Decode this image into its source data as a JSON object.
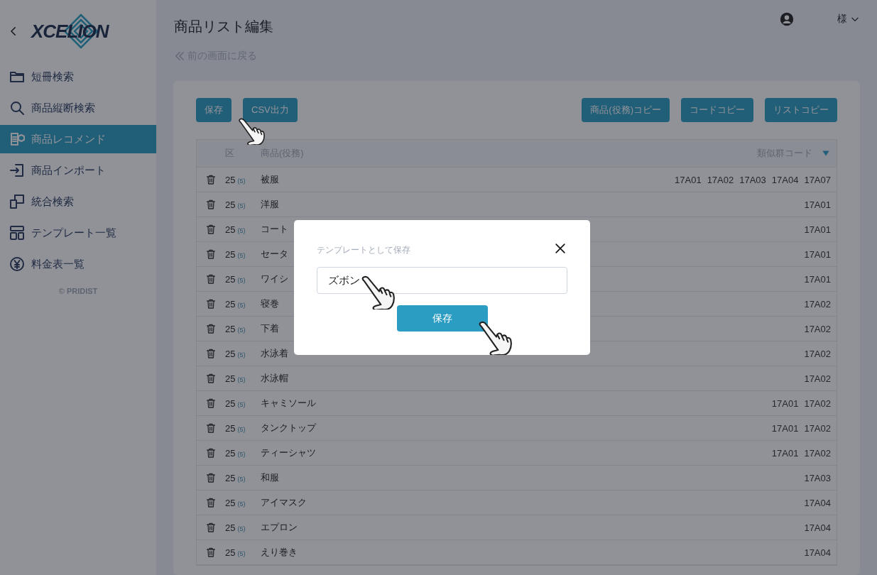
{
  "sidebar": {
    "logo": "XCELION",
    "items": [
      {
        "label": "短冊検索",
        "selected": false
      },
      {
        "label": "商品縦断検索",
        "selected": false
      },
      {
        "label": "商品レコメンド",
        "selected": true
      },
      {
        "label": "商品インポート",
        "selected": false
      },
      {
        "label": "統合検索",
        "selected": false
      },
      {
        "label": "テンプレート一覧",
        "selected": false
      },
      {
        "label": "料金表一覧",
        "selected": false
      }
    ],
    "copyright": "© PRIDIST"
  },
  "header": {
    "title": "商品リスト編集",
    "user_suffix": "様",
    "back_link": "前の画面に戻る"
  },
  "toolbar": {
    "left_buttons": [
      "保存",
      "CSV出力"
    ],
    "right_buttons": [
      "商品(役務)コピー",
      "コードコピー",
      "リストコピー"
    ]
  },
  "table": {
    "columns": [
      "区",
      "商品(役務)",
      "類似群コード"
    ],
    "rows": [
      {
        "class": "25",
        "count": "(5)",
        "name": "被服",
        "codes": [
          "17A01",
          "17A02",
          "17A03",
          "17A04",
          "17A07"
        ]
      },
      {
        "class": "25",
        "count": "(5)",
        "name": "洋服",
        "codes": [
          "17A01"
        ]
      },
      {
        "class": "25",
        "count": "(5)",
        "name": "コート",
        "codes": [
          "17A01"
        ]
      },
      {
        "class": "25",
        "count": "(5)",
        "name": "セータ",
        "codes": [
          "17A01"
        ]
      },
      {
        "class": "25",
        "count": "(5)",
        "name": "ワイシ",
        "codes": [
          "17A01"
        ]
      },
      {
        "class": "25",
        "count": "(5)",
        "name": "寝巻",
        "codes": [
          "17A02"
        ]
      },
      {
        "class": "25",
        "count": "(5)",
        "name": "下着",
        "codes": [
          "17A02"
        ]
      },
      {
        "class": "25",
        "count": "(5)",
        "name": "水泳着",
        "codes": [
          "17A02"
        ]
      },
      {
        "class": "25",
        "count": "(5)",
        "name": "水泳帽",
        "codes": [
          "17A02"
        ]
      },
      {
        "class": "25",
        "count": "(5)",
        "name": "キャミソール",
        "codes": [
          "17A01",
          "17A02"
        ]
      },
      {
        "class": "25",
        "count": "(5)",
        "name": "タンクトップ",
        "codes": [
          "17A01",
          "17A02"
        ]
      },
      {
        "class": "25",
        "count": "(5)",
        "name": "ティーシャツ",
        "codes": [
          "17A01",
          "17A02"
        ]
      },
      {
        "class": "25",
        "count": "(5)",
        "name": "和服",
        "codes": [
          "17A03"
        ]
      },
      {
        "class": "25",
        "count": "(5)",
        "name": "アイマスク",
        "codes": [
          "17A04"
        ]
      },
      {
        "class": "25",
        "count": "(5)",
        "name": "エプロン",
        "codes": [
          "17A04"
        ]
      },
      {
        "class": "25",
        "count": "(5)",
        "name": "えり巻き",
        "codes": [
          "17A04"
        ]
      }
    ]
  },
  "dialog": {
    "label": "テンプレートとして保存",
    "value": "ズボン",
    "button": "保存"
  }
}
